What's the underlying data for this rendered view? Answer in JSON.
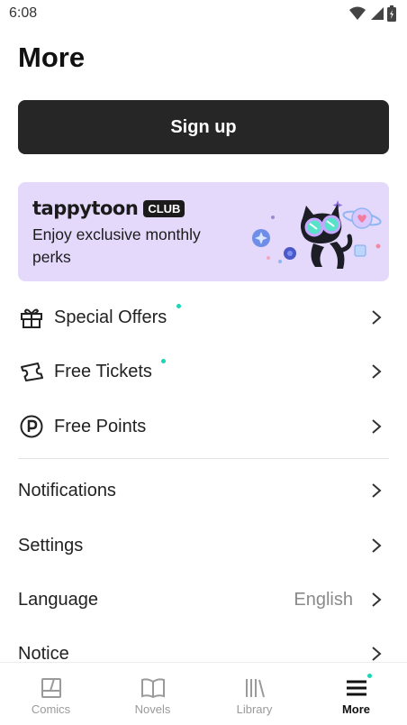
{
  "status_bar": {
    "time": "6:08",
    "icons": [
      "wifi-icon",
      "signal-icon",
      "battery-icon"
    ]
  },
  "header": {
    "title": "More"
  },
  "signup": {
    "label": "Sign up"
  },
  "club_banner": {
    "logo_text": "tappytoon",
    "tag": "CLUB",
    "text": "Enjoy exclusive monthly perks",
    "background": "#e4d9fb"
  },
  "menu": {
    "special_offers": {
      "label": "Special Offers",
      "icon": "gift-icon",
      "has_dot": true
    },
    "free_tickets": {
      "label": "Free Tickets",
      "icon": "ticket-icon",
      "has_dot": true
    },
    "free_points": {
      "label": "Free Points",
      "icon": "points-icon",
      "has_dot": false
    },
    "notifications": {
      "label": "Notifications"
    },
    "settings": {
      "label": "Settings"
    },
    "language": {
      "label": "Language",
      "value": "English"
    },
    "notice": {
      "label": "Notice"
    }
  },
  "bottom_nav": {
    "items": [
      {
        "label": "Comics",
        "icon": "comics-icon",
        "active": false
      },
      {
        "label": "Novels",
        "icon": "book-icon",
        "active": false
      },
      {
        "label": "Library",
        "icon": "library-icon",
        "active": false
      },
      {
        "label": "More",
        "icon": "menu-icon",
        "active": true
      }
    ]
  },
  "colors": {
    "accent_dot": "#19d6b4",
    "button_dark": "#262626",
    "text_muted": "#8a8a8a"
  }
}
